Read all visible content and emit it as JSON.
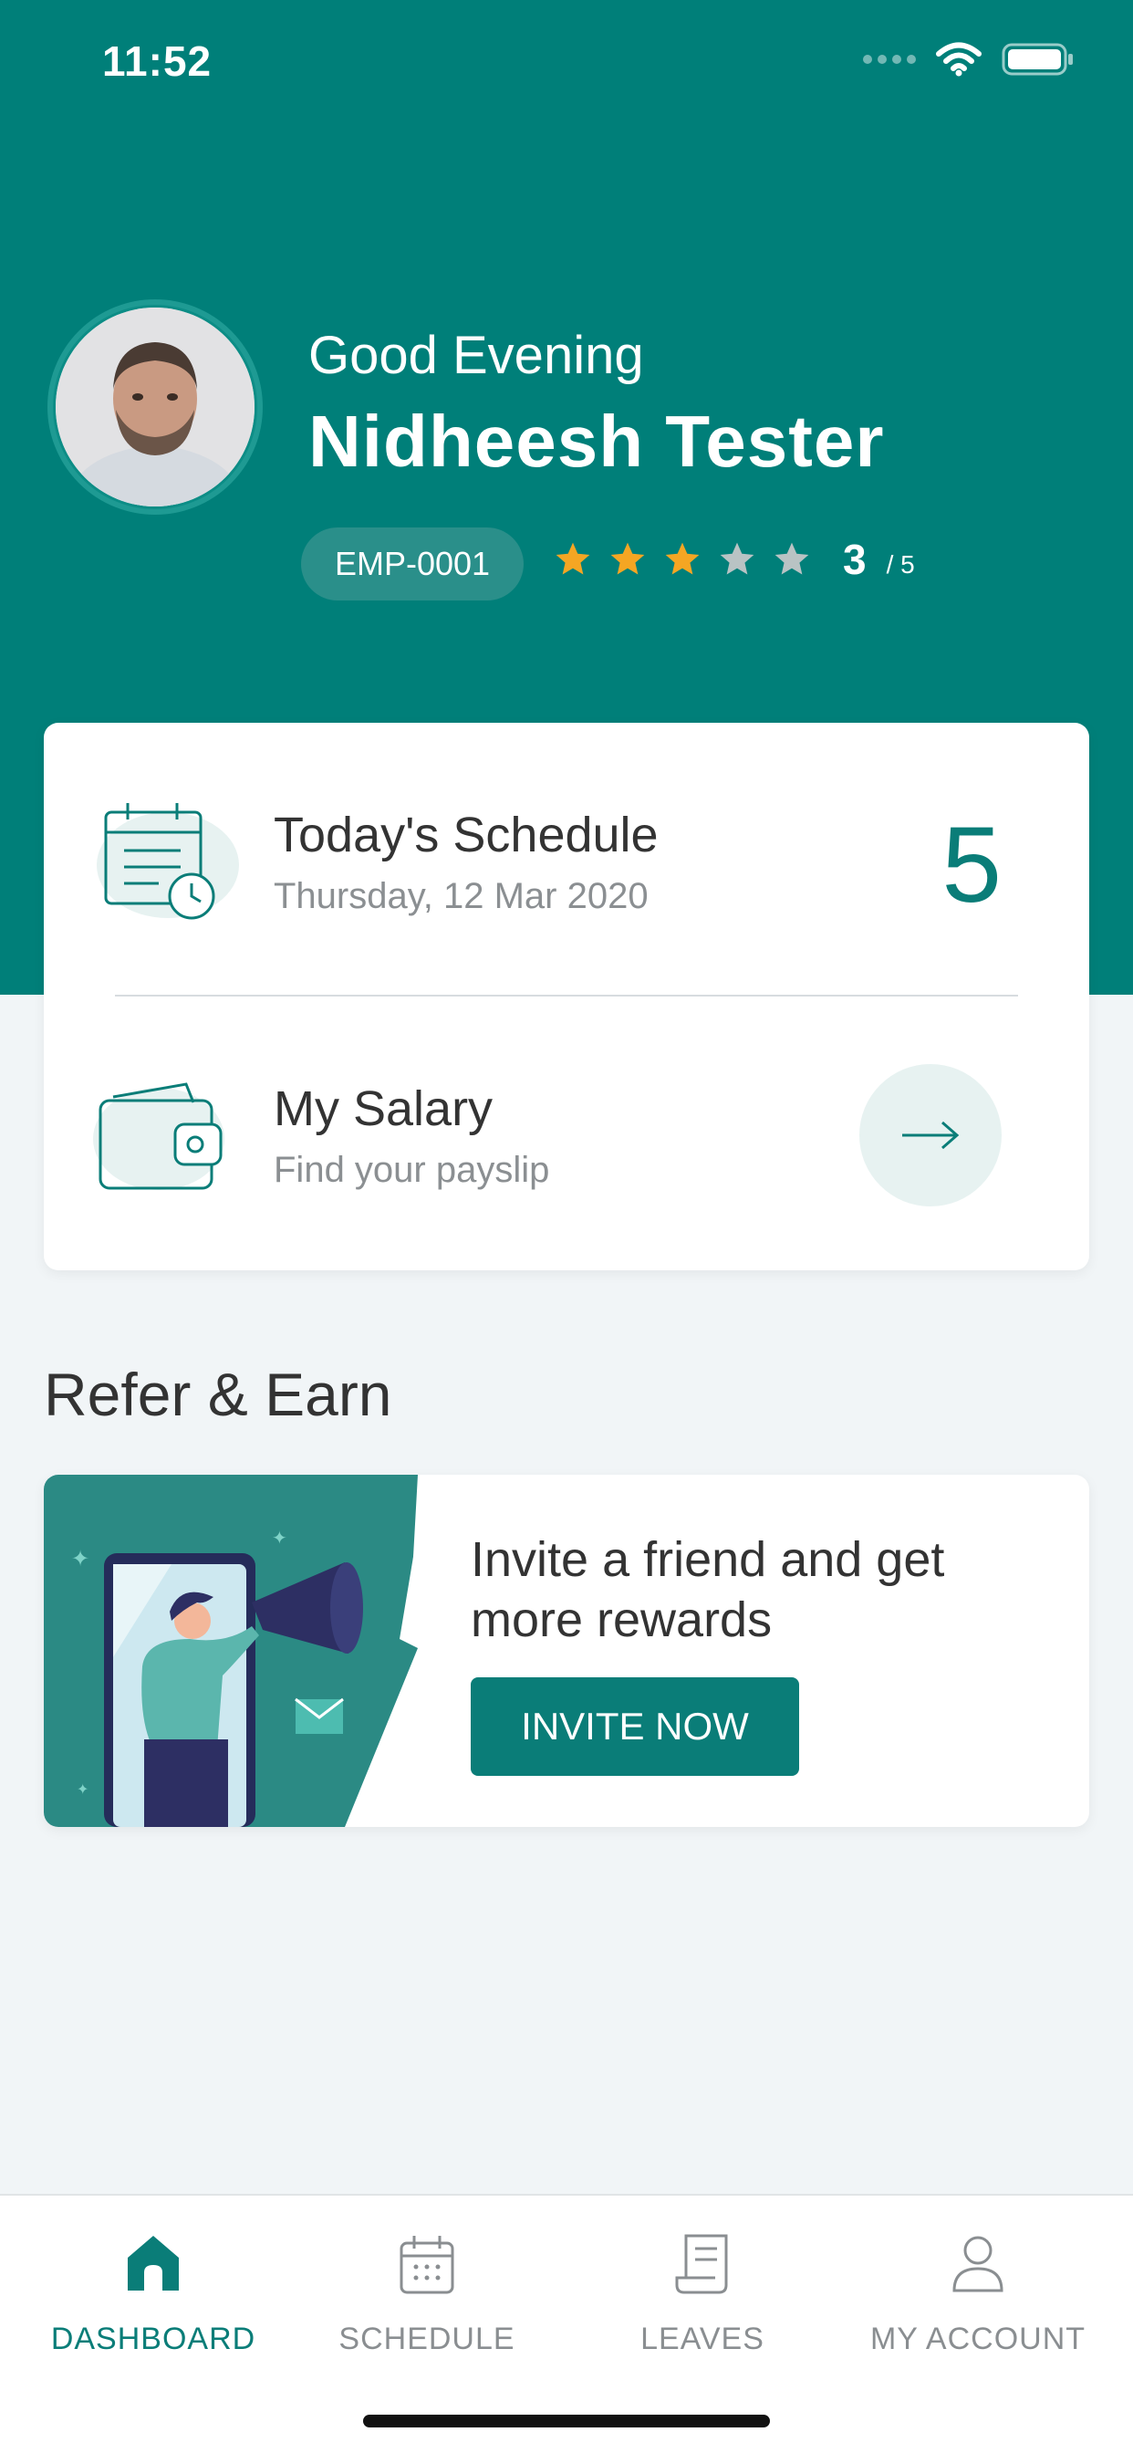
{
  "status_bar": {
    "time": "11:52"
  },
  "header": {
    "greeting": "Good Evening",
    "name": "Nidheesh Tester",
    "employee_id": "EMP-0001",
    "rating": {
      "value": 3,
      "max": 5,
      "value_label": "3",
      "max_label": "/ 5"
    }
  },
  "card": {
    "schedule": {
      "title": "Today's Schedule",
      "date": "Thursday, 12 Mar 2020",
      "count": "5"
    },
    "salary": {
      "title": "My Salary",
      "subtitle": "Find your payslip"
    }
  },
  "refer": {
    "heading": "Refer & Earn",
    "message": "Invite a friend and get more rewards",
    "button_label": "INVITE NOW"
  },
  "tabbar": {
    "items": [
      {
        "label": "DASHBOARD",
        "icon": "home-icon",
        "active": true
      },
      {
        "label": "SCHEDULE",
        "icon": "calendar-icon",
        "active": false
      },
      {
        "label": "LEAVES",
        "icon": "document-icon",
        "active": false
      },
      {
        "label": "MY ACCOUNT",
        "icon": "user-icon",
        "active": false
      }
    ]
  },
  "colors": {
    "primary": "#007f79",
    "accent_teal": "#0a7d78",
    "star_filled": "#f5a623",
    "star_empty": "#b9c3c4",
    "background": "#f1f5f7"
  }
}
